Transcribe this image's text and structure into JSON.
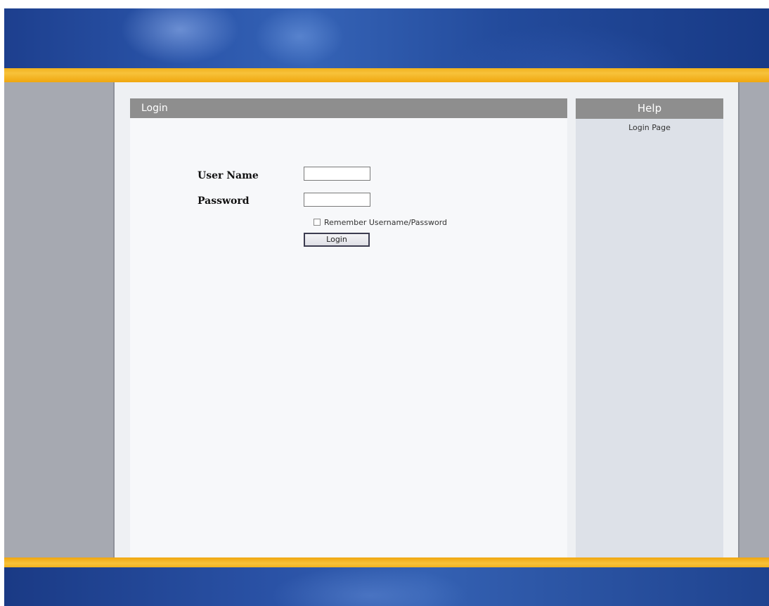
{
  "main": {
    "header_title": "Login",
    "form": {
      "username_label": "User Name",
      "username_value": "",
      "password_label": "Password",
      "password_value": "",
      "remember_label": "Remember Username/Password",
      "remember_checked": false,
      "login_button_label": "Login"
    }
  },
  "help": {
    "header_title": "Help",
    "text": "Login Page"
  },
  "colors": {
    "banner_blue": "#2b56ab",
    "accent_orange": "#f2b21d",
    "panel_header_gray": "#8e8e8e",
    "side_gray": "#a6a9b1"
  }
}
